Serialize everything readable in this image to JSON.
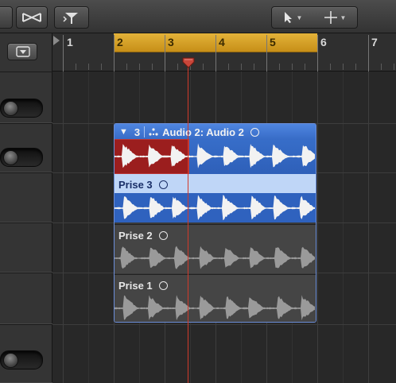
{
  "toolbar": {
    "buttons": [
      {
        "name": "crossfade-tool-icon"
      },
      {
        "name": "flex-pointer-icon"
      },
      {
        "name": "pointer-tool-icon",
        "caret": "▼"
      },
      {
        "name": "marquee-tool-icon",
        "caret": "▼"
      }
    ]
  },
  "track_header": {
    "menu_icon": "dropdown-menu-icon",
    "toggles": [
      "on",
      "on",
      "on"
    ]
  },
  "ruler": {
    "bars": [
      "1",
      "2",
      "3",
      "4",
      "5",
      "6",
      "7"
    ],
    "cycle_range": [
      "2",
      "6"
    ]
  },
  "folder": {
    "disclosure": "▼",
    "take_count": "3",
    "title": "Audio 2: Audio 2",
    "color": "#3b74d0"
  },
  "takes": [
    {
      "label": "Prise 3",
      "active": true
    },
    {
      "label": "Prise 2",
      "active": false
    },
    {
      "label": "Prise 1",
      "active": false
    }
  ],
  "colors": {
    "cycle": "#d9a52d",
    "playhead": "#d23a2a",
    "selection": "#9b1e1e",
    "active_take": "#bfd6f7"
  }
}
